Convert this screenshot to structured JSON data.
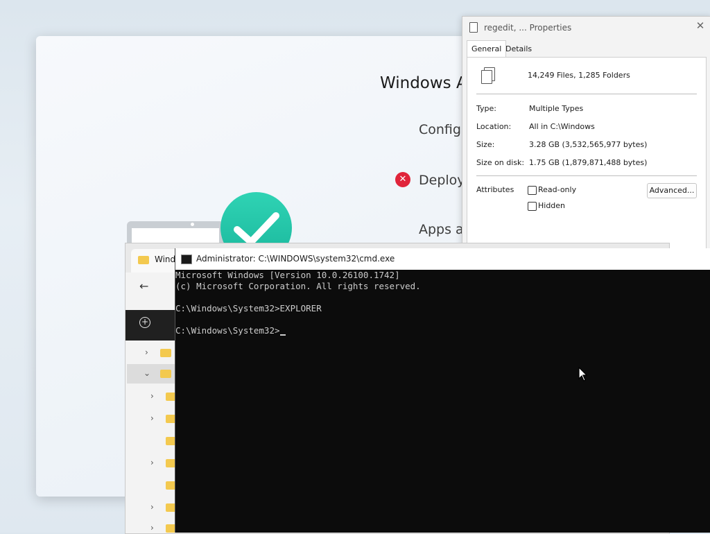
{
  "autopilot": {
    "title": "Windows A",
    "steps": [
      "Configu",
      "Deploy",
      "Apps a"
    ],
    "error_glyph": "✕"
  },
  "properties": {
    "title": "regedit, ... Properties",
    "close_glyph": "✕",
    "tabs": [
      "General",
      "Details"
    ],
    "summary": "14,249 Files, 1,285 Folders",
    "rows": [
      {
        "label": "Type:",
        "value": "Multiple Types"
      },
      {
        "label": "Location:",
        "value": "All in C:\\Windows"
      },
      {
        "label": "Size:",
        "value": "3.28 GB (3,532,565,977 bytes)"
      },
      {
        "label": "Size on disk:",
        "value": "1.75 GB (1,879,871,488 bytes)"
      }
    ],
    "attributes_label": "Attributes",
    "checkboxes": [
      "Read-only",
      "Hidden"
    ],
    "advanced_button": "Advanced..."
  },
  "explorer": {
    "tab_label": "Wind",
    "back_glyph": "←",
    "new_glyph": "+"
  },
  "cmd": {
    "title": "Administrator: C:\\WINDOWS\\system32\\cmd.exe",
    "lines": [
      "Microsoft Windows [Version 10.0.26100.1742]",
      "(c) Microsoft Corporation. All rights reserved.",
      "",
      "C:\\Windows\\System32>EXPLORER",
      "",
      "C:\\Windows\\System32>"
    ]
  }
}
